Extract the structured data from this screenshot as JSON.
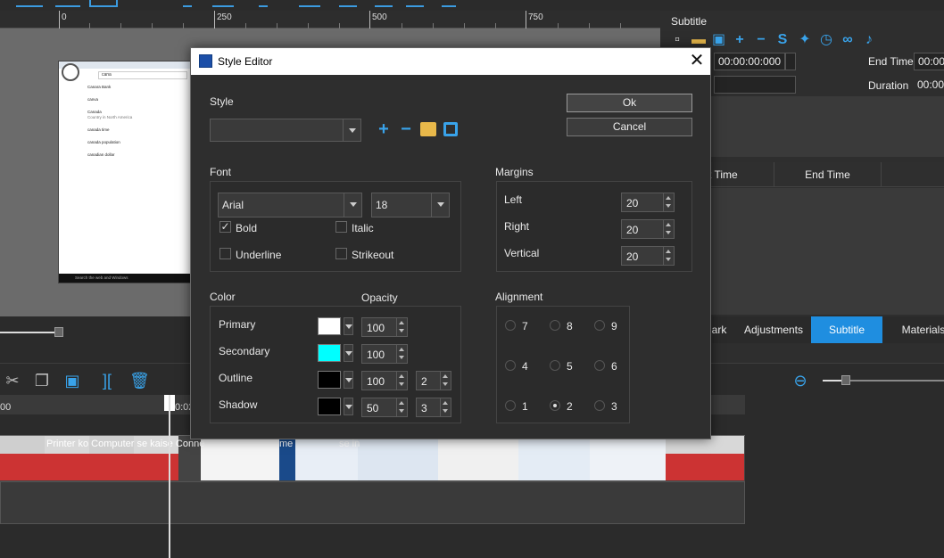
{
  "ruler": {
    "ticks": [
      "0",
      "250",
      "500",
      "750"
    ]
  },
  "right_panel": {
    "title": "Subtitle",
    "start_value": "00:00:00:000",
    "end_time_label": "End Time",
    "end_value": "00:00:",
    "duration_label": "Duration",
    "duration_value": "00:00:",
    "grid_columns": [
      "rt Time",
      "End Time"
    ],
    "tabs": [
      "ark",
      "Adjustments",
      "Subtitle",
      "Materials"
    ]
  },
  "timeline": {
    "time_start": "00",
    "time_mark": "0:02",
    "caption": "Printer ko Computer se kaise Conne",
    "caption2": "me",
    "caption3": "se in"
  },
  "preview": {
    "search_text": "cana",
    "suggestions": [
      "Canara Bank",
      "canva",
      "Canada",
      "canada time",
      "canada population",
      "canadian dollar"
    ],
    "suggestion_sub": "Country in North America",
    "taskbar_text": "Search the web and Windows"
  },
  "dialog": {
    "title": "Style Editor",
    "style_label": "Style",
    "style_value": "",
    "ok_label": "Ok",
    "cancel_label": "Cancel",
    "font_label": "Font",
    "font_name": "Arial",
    "font_size": "18",
    "bold_label": "Bold",
    "italic_label": "Italic",
    "underline_label": "Underline",
    "strikeout_label": "Strikeout",
    "margins_label": "Margins",
    "margin_left_label": "Left",
    "margin_left": "20",
    "margin_right_label": "Right",
    "margin_right": "20",
    "margin_vertical_label": "Vertical",
    "margin_vertical": "20",
    "color_label": "Color",
    "opacity_label": "Opacity",
    "colors": [
      {
        "label": "Primary",
        "swatch": "#ffffff",
        "opacity": "100",
        "extra": ""
      },
      {
        "label": "Secondary",
        "swatch": "#00ffff",
        "opacity": "100",
        "extra": ""
      },
      {
        "label": "Outline",
        "swatch": "#000000",
        "opacity": "100",
        "extra": "2"
      },
      {
        "label": "Shadow",
        "swatch": "#000000",
        "opacity": "50",
        "extra": "3"
      }
    ],
    "alignment_label": "Alignment",
    "alignment_options": [
      "7",
      "8",
      "9",
      "4",
      "5",
      "6",
      "1",
      "2",
      "3"
    ],
    "alignment_selected": "2"
  },
  "colors": {
    "accent": "#1f8ee0",
    "icon_blue": "#39a3ea",
    "folder": "#e8b84a"
  }
}
